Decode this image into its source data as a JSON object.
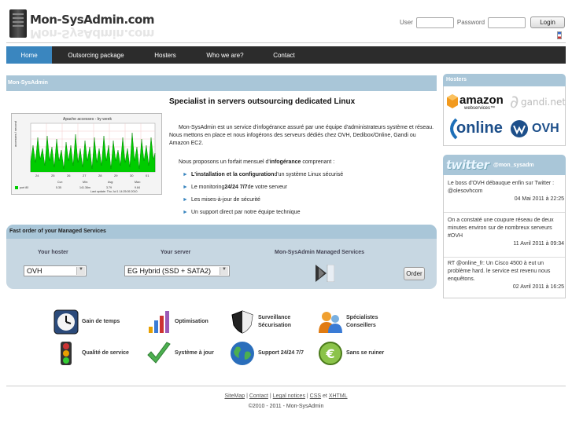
{
  "header": {
    "logo_text": "Mon-SysAdmin.com",
    "login": {
      "user_label": "User",
      "password_label": "Password",
      "button": "Login"
    }
  },
  "nav": {
    "items": [
      "Home",
      "Outsorcing package",
      "Hosters",
      "Who we are?",
      "Contact"
    ],
    "active": "Home"
  },
  "main": {
    "panel_title": "Mon-SysAdmin",
    "title": "Specialist in servers outsourcing dedicated Linux",
    "graph_title": "Apache accesses - by week",
    "intro": "Mon-SysAdmin est un service d'infogérance assuré par une équipe d'administrateurs système et réseau. Nous mettons en place et nous infogérons des serveurs dédiés chez OVH, Dedibox/Online, Gandi ou Amazon EC2.",
    "offer_prefix": "Nous proposons un forfait mensuel d'",
    "offer_bold": "infogérance",
    "offer_suffix": " comprenant :",
    "bullets": [
      {
        "bold": "L'installation et la configuration",
        "rest": " d'un système Linux sécurisé"
      },
      {
        "pre": "Le monitoring ",
        "bold": "24/24 7/7",
        "rest": " de votre serveur"
      },
      {
        "pre": "Les mises-à-jour de sécurité"
      },
      {
        "pre": "Un support direct par notre équipe technique"
      }
    ]
  },
  "order": {
    "title": "Fast order of your Managed Services",
    "col_hoster": "Your hoster",
    "col_server": "Your server",
    "col_services": "Mon-SysAdmin Managed Services",
    "hoster_value": "OVH",
    "server_value": "EG Hybrid (SSD + SATA2)",
    "button": "Order"
  },
  "features": [
    {
      "label": "Gain de temps",
      "icon": "clock-icon"
    },
    {
      "label": "Optimisation",
      "icon": "bar-chart-icon"
    },
    {
      "label": "Surveillance Sécurisation",
      "icon": "shield-icon"
    },
    {
      "label": "Spécialistes Conseillers",
      "icon": "people-icon"
    },
    {
      "label": "Qualité de service",
      "icon": "traffic-light-icon"
    },
    {
      "label": "Système à jour",
      "icon": "checkmark-icon"
    },
    {
      "label": "Support 24/24 7/7",
      "icon": "globe-icon"
    },
    {
      "label": "Sans se ruiner",
      "icon": "euro-icon"
    }
  ],
  "sidebar": {
    "hosters_title": "Hosters",
    "hosters": [
      "amazon",
      "gandi.net",
      "online",
      "OVH"
    ],
    "twitter_word": "twitter",
    "twitter_user": "@mon_sysadm",
    "tweets": [
      {
        "text": "Le boss d'OVH débauque enfin sur Twitter : @olesovhcom",
        "date": "04 Mai 2011 à 22:25"
      },
      {
        "text": "On a constaté une coupure réseau de deux minutes environ sur de nombreux serveurs #OVH",
        "date": "11 Avril 2011 à 09:34"
      },
      {
        "text": "RT @online_fr: Un Cisco 4500 à eut un problème hard. le service est revenu nous enquêtons.",
        "date": "02 Avril 2011 à 16:25"
      }
    ]
  },
  "footer": {
    "links": [
      "SiteMap",
      "Contact",
      "Legal notices",
      "CSS",
      "XHTML"
    ],
    "and_word": "et",
    "copyright": "©2010 - 2011  -  Mon-SysAdmin"
  },
  "colors": {
    "nav_bg": "#2c2c2c",
    "nav_active": "#3a86bf",
    "panel_head": "#a9c6d8",
    "order_bg": "#c7d7e2"
  }
}
